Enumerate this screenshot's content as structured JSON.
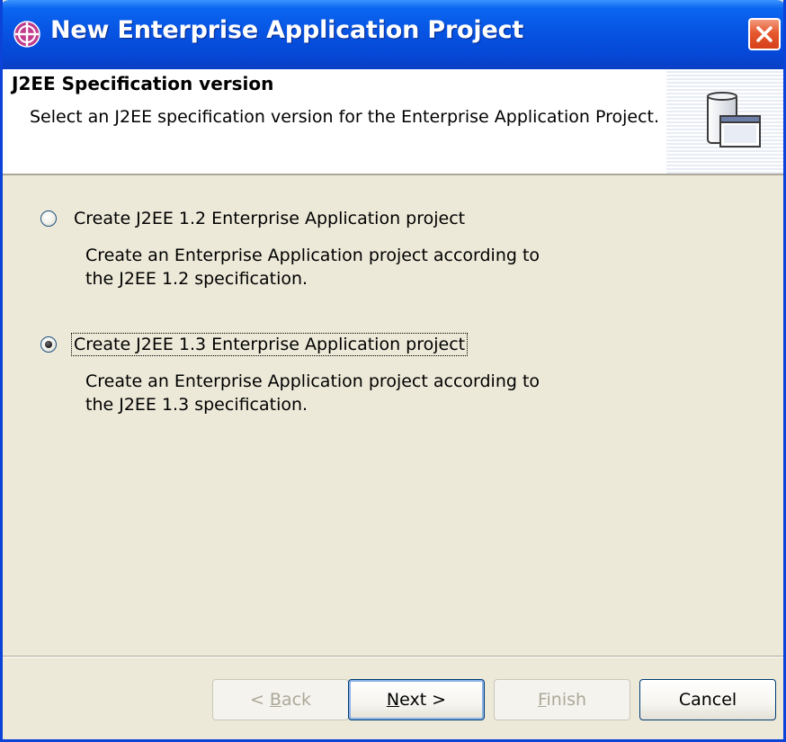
{
  "window": {
    "title": "New Enterprise Application Project"
  },
  "banner": {
    "title": "J2EE Specification version",
    "description": "Select an J2EE specification version for the Enterprise Application Project."
  },
  "options": [
    {
      "label": "Create J2EE 1.2 Enterprise Application project",
      "description_line1": "Create an Enterprise Application project according to",
      "description_line2": "the J2EE 1.2 specification.",
      "selected": false
    },
    {
      "label": "Create J2EE 1.3 Enterprise Application project",
      "description_line1": "Create an Enterprise Application project according to",
      "description_line2": "the J2EE 1.3 specification.",
      "selected": true
    }
  ],
  "buttons": {
    "back": {
      "prefix": "< ",
      "mnemonic": "B",
      "rest": "ack",
      "enabled": false
    },
    "next": {
      "mnemonic": "N",
      "rest": "ext >",
      "enabled": true
    },
    "finish": {
      "mnemonic": "F",
      "rest": "inish",
      "enabled": false
    },
    "cancel": {
      "label": "Cancel",
      "enabled": true
    }
  },
  "icons": {
    "title": "eclipse-wizard-icon",
    "close": "close-icon",
    "banner": "jar-window-icon"
  },
  "colors": {
    "titlebar": "#0754e3",
    "close": "#e5592f",
    "dialog_bg": "#ece9d8"
  }
}
